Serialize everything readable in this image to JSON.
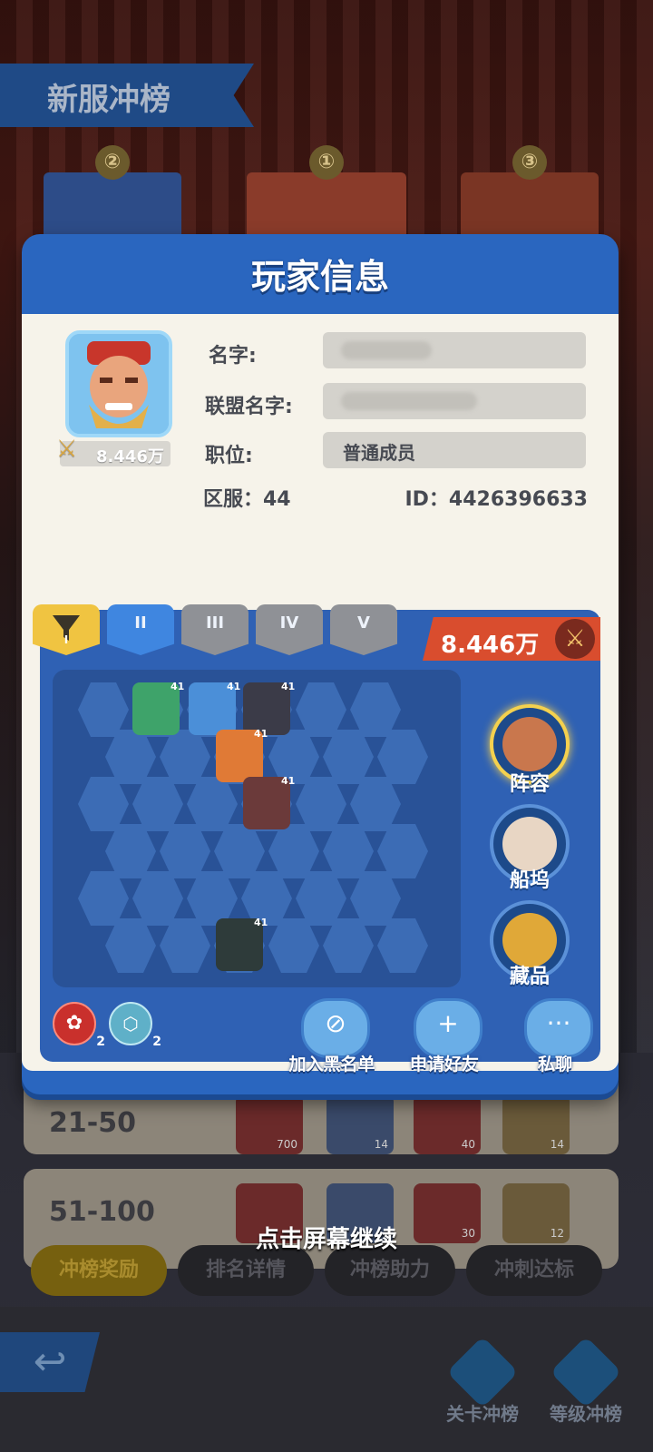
{
  "background": {
    "banner_title": "新服冲榜",
    "podium": [
      {
        "rank": "②"
      },
      {
        "rank": "①"
      },
      {
        "rank": "③"
      }
    ],
    "rank_rows": [
      {
        "label": "21-50",
        "items": [
          "700",
          "14",
          "40",
          "14"
        ]
      },
      {
        "label": "51-100",
        "items": [
          "",
          "",
          "30",
          "12"
        ]
      }
    ],
    "continue_text": "点击屏幕继续",
    "tabs": [
      "冲榜奖励",
      "排名详情",
      "冲榜助力",
      "冲刺达标"
    ],
    "nav": [
      "关卡冲榜",
      "等级冲榜"
    ]
  },
  "dialog": {
    "title": "玩家信息",
    "power_small": "8.446万",
    "fields": {
      "name_label": "名字:",
      "alliance_label": "联盟名字:",
      "position_label": "职位:",
      "position_value": "普通成员"
    },
    "server": "区服：44",
    "id": "ID：4426396633",
    "lineup": {
      "tabs": [
        "I",
        "II",
        "III",
        "IV",
        "V"
      ],
      "active_tab": "I",
      "power": "8.446万",
      "hero_levels": [
        "41",
        "41",
        "41",
        "41",
        "41",
        "41"
      ],
      "side": [
        "阵容",
        "船坞",
        "藏品"
      ],
      "synergies": [
        {
          "icon": "paw-icon",
          "count": "2"
        },
        {
          "icon": "shield-icon",
          "count": "2"
        }
      ]
    },
    "actions": [
      "加入黑名单",
      "申请好友",
      "私聊"
    ]
  },
  "colors": {
    "accent_blue": "#2a66bf",
    "panel_bg": "#f6f3ea",
    "badge_red": "#d94d2e",
    "tab_yellow": "#f0c441"
  }
}
